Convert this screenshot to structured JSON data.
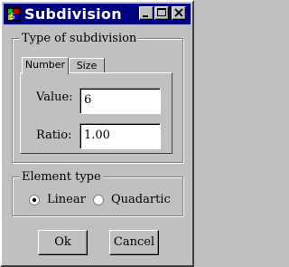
{
  "window": {
    "title": "Subdivision",
    "titlebar_color": "#000080",
    "icon": "app-icon",
    "controls": [
      "minimize-icon",
      "maximize-icon",
      "close-icon"
    ]
  },
  "subdivision_group": {
    "legend": "Type of subdivision",
    "tabs": [
      {
        "label": "Number",
        "active": true
      },
      {
        "label": "Size",
        "active": false
      }
    ],
    "fields": {
      "value_label": "Value:",
      "value": "6",
      "ratio_label": "Ratio:",
      "ratio": "1.00"
    }
  },
  "element_type_group": {
    "legend": "Element type",
    "options": [
      {
        "label": "Linear",
        "selected": true
      },
      {
        "label": "Quadartic",
        "selected": false
      }
    ]
  },
  "buttons": {
    "ok": "Ok",
    "cancel": "Cancel"
  }
}
